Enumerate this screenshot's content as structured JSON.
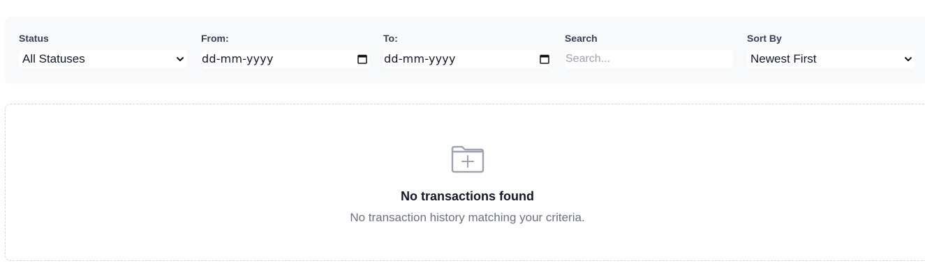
{
  "filters": {
    "status": {
      "label": "Status",
      "selected": "All Statuses",
      "icon": "chevron-down-icon"
    },
    "from": {
      "label": "From:",
      "value": "dd-mm-yyyy",
      "icon": "calendar-icon"
    },
    "to": {
      "label": "To:",
      "value": "dd-mm-yyyy",
      "icon": "calendar-icon"
    },
    "search": {
      "label": "Search",
      "placeholder": "Search..."
    },
    "sort": {
      "label": "Sort By",
      "selected": "Newest First",
      "icon": "chevron-down-icon"
    }
  },
  "empty_state": {
    "icon": "folder-plus-icon",
    "title": "No transactions found",
    "description": "No transaction history matching your criteria."
  },
  "colors": {
    "panel_background": "#f8f9fb",
    "muted_text": "#6b7280",
    "icon_gray": "#9ca3af"
  }
}
